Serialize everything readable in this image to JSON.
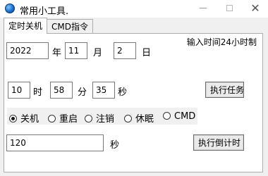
{
  "window": {
    "title": "常用小工具.",
    "icon": "globe-icon"
  },
  "tabs": [
    {
      "label": "定时关机",
      "active": true
    },
    {
      "label": "CMD指令",
      "active": false
    }
  ],
  "panel": {
    "hint": "输入时间24小时制",
    "date": {
      "year": "2022",
      "year_label": "年",
      "month": "11",
      "month_label": "月",
      "day": "2",
      "day_label": "日"
    },
    "time": {
      "hour": "10",
      "hour_label": "时",
      "minute": "58",
      "minute_label": "分",
      "second": "35",
      "second_label": "秒"
    },
    "execute_task_label": "执行任务",
    "actions": [
      {
        "label": "关机",
        "checked": true
      },
      {
        "label": "重启",
        "checked": false
      },
      {
        "label": "注销",
        "checked": false
      },
      {
        "label": "休眠",
        "checked": false
      },
      {
        "label": "CMD",
        "checked": false
      }
    ],
    "countdown": {
      "value": "120",
      "unit_label": "秒",
      "execute_label": "执行倒计时"
    }
  }
}
